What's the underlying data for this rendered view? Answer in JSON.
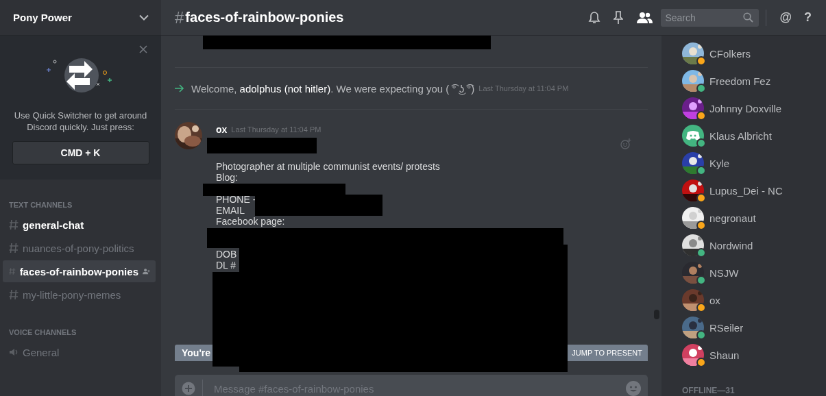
{
  "server": {
    "name": "Pony Power"
  },
  "quick_switcher": {
    "text": "Use Quick Switcher to get around Discord quickly. Just press:",
    "shortcut": "CMD + K"
  },
  "channel_groups": [
    {
      "title": "TEXT CHANNELS",
      "kind": "text",
      "channels": [
        {
          "name": "general-chat",
          "selected": false,
          "unread": true
        },
        {
          "name": "nuances-of-pony-politics",
          "selected": false,
          "unread": false
        },
        {
          "name": "faces-of-rainbow-ponies",
          "selected": true,
          "unread": false
        },
        {
          "name": "my-little-pony-memes",
          "selected": false,
          "unread": false
        }
      ]
    },
    {
      "title": "VOICE CHANNELS",
      "kind": "voice",
      "channels": [
        {
          "name": "General",
          "selected": false,
          "unread": false
        }
      ]
    }
  ],
  "channel_header": {
    "hash": "#",
    "name": "faces-of-rainbow-ponies"
  },
  "search": {
    "placeholder": "Search"
  },
  "toolbar_glyphs": [
    "@",
    "?"
  ],
  "system_message": {
    "text": "Welcome, **adolphus (not hitler)**. We were expecting you ( ͡° ͜ʖ ͡°)",
    "time": "Last Thursday at 11:04 PM"
  },
  "message": {
    "author": "ox",
    "time": "Last Thursday at 11:04 PM",
    "text": "Photographer at multiple communist events/ protests\nBlog:\n\nPHONE -\nEMAIL\nFacebook page:\n\n\nDOB\nDL #"
  },
  "new_messages_bar": {
    "text": "You're",
    "button": "JUMP TO PRESENT"
  },
  "composer": {
    "placeholder": "Message #faces-of-rainbow-ponies"
  },
  "members": [
    {
      "name": "CFolkers",
      "idle": true,
      "kind": "picture"
    },
    {
      "name": "Freedom Fez",
      "idle": false,
      "kind": "picture"
    },
    {
      "name": "Johnny Doxville",
      "idle": true,
      "kind": "picture"
    },
    {
      "name": "Klaus Albricht",
      "idle": false,
      "kind": "default"
    },
    {
      "name": "Kyle",
      "idle": false,
      "kind": "picture"
    },
    {
      "name": "Lupus_Dei - NC",
      "idle": true,
      "kind": "picture"
    },
    {
      "name": "negronaut",
      "idle": true,
      "kind": "picture"
    },
    {
      "name": "Nordwind",
      "idle": false,
      "kind": "picture"
    },
    {
      "name": "NSJW",
      "idle": false,
      "kind": "picture"
    },
    {
      "name": "ox",
      "idle": true,
      "kind": "picture"
    },
    {
      "name": "RSeiler",
      "idle": false,
      "kind": "picture"
    },
    {
      "name": "Shaun",
      "idle": true,
      "kind": "picture"
    }
  ],
  "offline_header": "OFFLINE—31"
}
